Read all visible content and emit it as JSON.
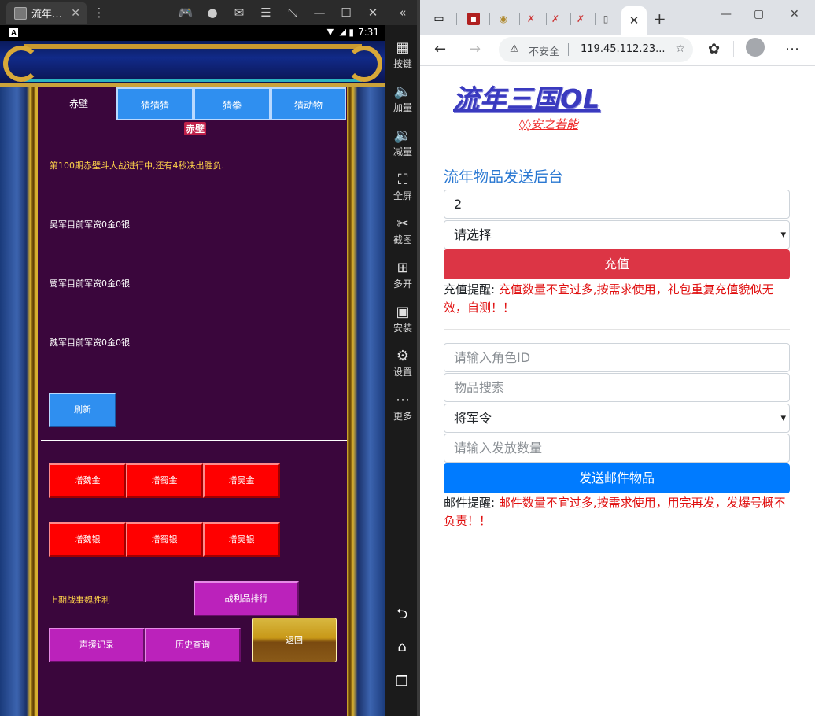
{
  "emulator": {
    "tab_title": "流年…",
    "tab_close": "✕",
    "status_time": "7:31",
    "status_battery": "▮",
    "status_signal": "▼ ◢",
    "toolbar_icons": [
      "gamepad-icon",
      "account-icon",
      "mail-icon",
      "menu-icon",
      "resize-icon",
      "minimize-icon",
      "maximize-icon",
      "close-icon",
      "collapse-icon"
    ],
    "side_items": [
      {
        "icon": "▦",
        "label": "按键"
      },
      {
        "icon": "🔈",
        "label": "加量"
      },
      {
        "icon": "🔉",
        "label": "减量"
      },
      {
        "icon": "⛶",
        "label": "全屏"
      },
      {
        "icon": "✂",
        "label": "截图"
      },
      {
        "icon": "⊞",
        "label": "多开"
      },
      {
        "icon": "▣",
        "label": "安装"
      },
      {
        "icon": "⚙",
        "label": "设置"
      },
      {
        "icon": "⋯",
        "label": "更多"
      }
    ],
    "nav": {
      "back": "⮌",
      "home": "⌂",
      "recent": "❐"
    }
  },
  "game": {
    "tabs": [
      "赤壁",
      "猜猜猜",
      "猜拳",
      "猜动物"
    ],
    "section_label": "赤壁",
    "battle_status": "第100期赤壁斗大战进行中,还有4秒决出胜负.",
    "wu_funds": "吴军目前军资0金0银",
    "shu_funds": "蜀军目前军资0金0银",
    "wei_funds": "魏军目前军资0金0银",
    "refresh_button": "刷新",
    "gold_buttons": [
      "增魏金",
      "增蜀金",
      "增吴金"
    ],
    "silver_buttons": [
      "增魏银",
      "增蜀银",
      "增吴银"
    ],
    "last_result": "上期战事魏胜利",
    "ranking_button": "战利品排行",
    "support_button": "声援记录",
    "history_button": "历史查询",
    "back_button": "返回"
  },
  "browser": {
    "window_controls": {
      "minimize": "—",
      "maximize": "▢",
      "close": "✕"
    },
    "active_tab_close": "✕",
    "new_tab": "+",
    "address": {
      "warning_icon": "⚠",
      "insecure_label": "不安全",
      "url": "119.45.112.23...",
      "star_icon": "☆"
    }
  },
  "page": {
    "logo_title": "流年三国OL",
    "logo_subtitle": "◊◊安之若能",
    "heading": "流年物品发送后台",
    "recharge_amount_value": "2",
    "recharge_select_value": "请选择",
    "recharge_button": "充值",
    "recharge_note_label": "充值提醒: ",
    "recharge_note_text": "充值数量不宜过多,按需求使用，礼包重复充值貌似无效，自测！！",
    "role_id_placeholder": "请输入角色ID",
    "item_search_placeholder": "物品搜索",
    "item_select_value": "将军令",
    "quantity_placeholder": "请输入发放数量",
    "send_button": "发送邮件物品",
    "mail_note_label": "邮件提醒: ",
    "mail_note_text": "邮件数量不宜过多,按需求使用，用完再发，发爆号概不负责！！"
  }
}
